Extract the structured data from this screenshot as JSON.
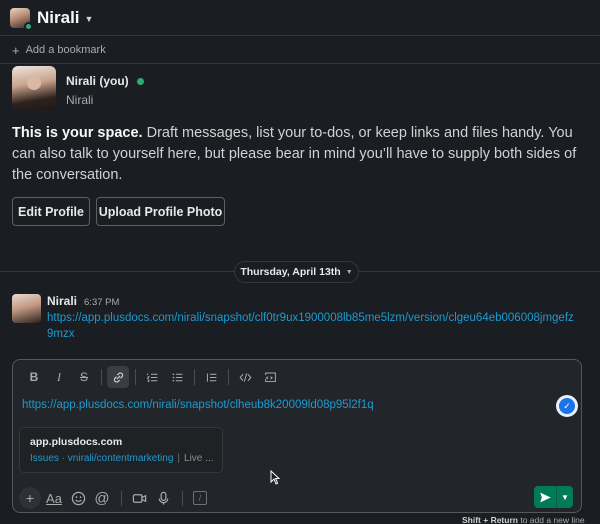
{
  "header": {
    "user_name": "Nirali"
  },
  "bookmark": {
    "label": "Add a bookmark"
  },
  "profile": {
    "display_name": "Nirali (you)",
    "username": "Nirali",
    "description_bold": "This is your space.",
    "description_rest": " Draft messages, list your to-dos, or keep links and files handy. You can also talk to yourself here, but please bear in mind you’ll have to supply both sides of the conversation.",
    "edit_button": "Edit Profile",
    "upload_button": "Upload Profile Photo"
  },
  "date_divider": {
    "label": "Thursday, April 13th"
  },
  "message": {
    "author": "Nirali",
    "time": "6:37 PM",
    "link": "https://app.plusdocs.com/nirali/snapshot/clf0tr9ux1900008lb85me5lzm/version/clgeu64eb006008jmgefz9mzx"
  },
  "composer": {
    "link": "https://app.plusdocs.com/nirali/snapshot/clheub8k20009ld08p95l2f1q",
    "preview": {
      "domain": "app.plusdocs.com",
      "crumb": "Issues · vnirali/contentmarketing",
      "extra": "Live ..."
    },
    "toolbar_icons": [
      "bold-icon",
      "italic-icon",
      "strikethrough-icon",
      "link-icon",
      "ordered-list-icon",
      "bullet-list-icon",
      "blockquote-icon",
      "code-icon",
      "code-block-icon"
    ],
    "bottom_icons": [
      "plus-icon",
      "format-icon",
      "emoji-icon",
      "mention-icon",
      "video-icon",
      "microphone-icon",
      "slash-icon"
    ]
  },
  "hint": {
    "shortcut": "Shift + Return",
    "text": " to add a new line"
  },
  "colors": {
    "link": "#1d9bd1",
    "online": "#2bac76",
    "send": "#007a5a",
    "background": "#1a1d21"
  }
}
